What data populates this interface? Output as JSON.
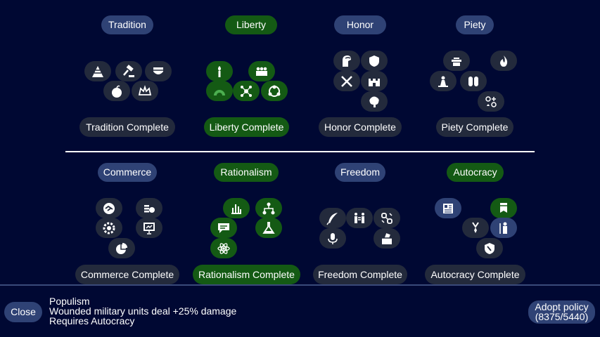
{
  "branches": {
    "tradition": {
      "title": "Tradition",
      "complete": "Tradition Complete"
    },
    "liberty": {
      "title": "Liberty",
      "complete": "Liberty Complete"
    },
    "honor": {
      "title": "Honor",
      "complete": "Honor Complete"
    },
    "piety": {
      "title": "Piety",
      "complete": "Piety Complete"
    },
    "commerce": {
      "title": "Commerce",
      "complete": "Commerce Complete"
    },
    "rationalism": {
      "title": "Rationalism",
      "complete": "Rationalism Complete"
    },
    "freedom": {
      "title": "Freedom",
      "complete": "Freedom Complete"
    },
    "autocracy": {
      "title": "Autocracy",
      "complete": "Autocracy Complete"
    }
  },
  "selected_policy": {
    "name": "Populism",
    "effect": "Wounded military units deal +25% damage",
    "requirement": "Requires Autocracy"
  },
  "buttons": {
    "close": "Close",
    "adopt_line1": "Adopt policy",
    "adopt_line2": "(8375/5440)"
  },
  "colors": {
    "background": "#000833",
    "adopted": "#145a14",
    "available": "#2f4275",
    "locked": "#232a3c"
  }
}
